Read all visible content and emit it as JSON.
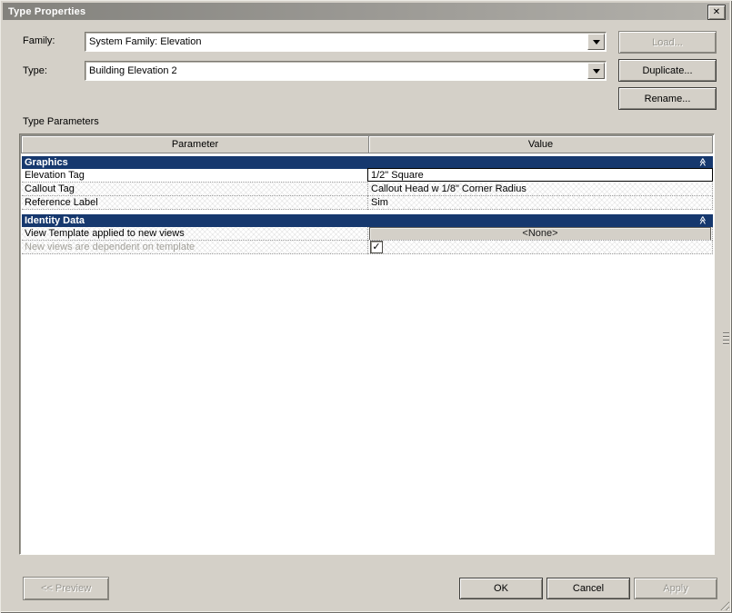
{
  "window": {
    "title": "Type Properties"
  },
  "icons": {
    "close": "✕",
    "collapse_chevron": "≪",
    "check": "✓"
  },
  "form": {
    "family": {
      "label": "Family:",
      "value": "System Family: Elevation"
    },
    "type": {
      "label": "Type:",
      "value": "Building Elevation 2"
    },
    "load_button": "Load...",
    "duplicate_button": "Duplicate...",
    "rename_button": "Rename..."
  },
  "parameters": {
    "title": "Type Parameters",
    "columns": {
      "parameter": "Parameter",
      "value": "Value"
    },
    "groups": [
      {
        "name": "Graphics",
        "rows": [
          {
            "parameter": "Elevation Tag",
            "value": "1/2\" Square",
            "state": "editing"
          },
          {
            "parameter": "Callout Tag",
            "value": "Callout Head w 1/8\" Corner Radius"
          },
          {
            "parameter": "Reference Label",
            "value": "Sim"
          }
        ]
      },
      {
        "name": "Identity Data",
        "rows": [
          {
            "parameter": "View Template applied to new views",
            "value": "<None>",
            "control": "button"
          },
          {
            "parameter": "New views are dependent on template",
            "control": "checkbox",
            "checked": true
          }
        ]
      }
    ]
  },
  "footer": {
    "preview_button": "<< Preview",
    "ok_button": "OK",
    "cancel_button": "Cancel",
    "apply_button": "Apply"
  },
  "colors": {
    "dialog_bg": "#d4d0c8",
    "section_header_bg": "#16386e",
    "titlebar_gradient_start": "#83827d",
    "titlebar_gradient_end": "#b3b1ab",
    "disabled_text": "#98968f"
  }
}
